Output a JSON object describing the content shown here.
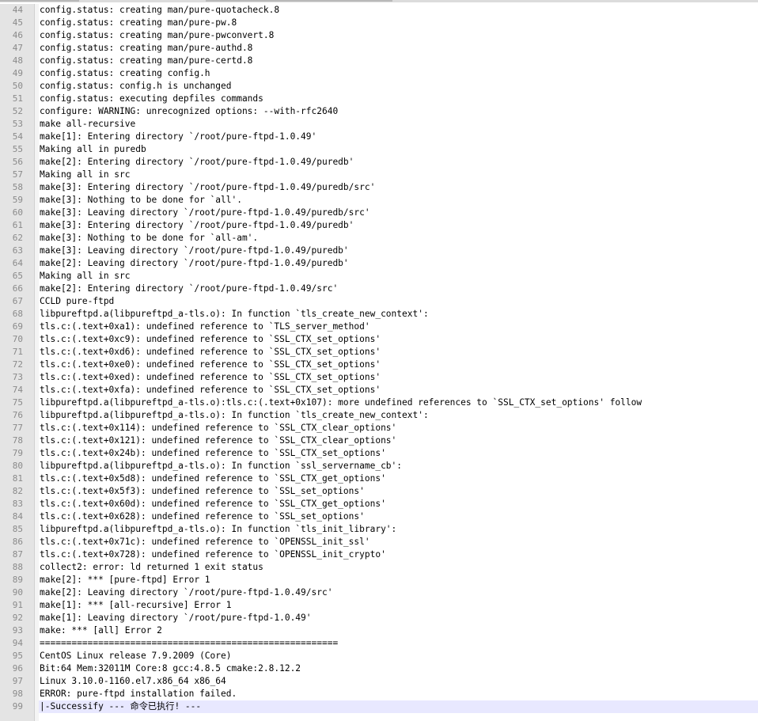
{
  "editor": {
    "current_line": 99,
    "lines": [
      {
        "n": 44,
        "text": "config.status: creating man/pure-quotacheck.8"
      },
      {
        "n": 45,
        "text": "config.status: creating man/pure-pw.8"
      },
      {
        "n": 46,
        "text": "config.status: creating man/pure-pwconvert.8"
      },
      {
        "n": 47,
        "text": "config.status: creating man/pure-authd.8"
      },
      {
        "n": 48,
        "text": "config.status: creating man/pure-certd.8"
      },
      {
        "n": 49,
        "text": "config.status: creating config.h"
      },
      {
        "n": 50,
        "text": "config.status: config.h is unchanged"
      },
      {
        "n": 51,
        "text": "config.status: executing depfiles commands"
      },
      {
        "n": 52,
        "text": "configure: WARNING: unrecognized options: --with-rfc2640"
      },
      {
        "n": 53,
        "text": "make all-recursive"
      },
      {
        "n": 54,
        "text": "make[1]: Entering directory `/root/pure-ftpd-1.0.49'"
      },
      {
        "n": 55,
        "text": "Making all in puredb"
      },
      {
        "n": 56,
        "text": "make[2]: Entering directory `/root/pure-ftpd-1.0.49/puredb'"
      },
      {
        "n": 57,
        "text": "Making all in src"
      },
      {
        "n": 58,
        "text": "make[3]: Entering directory `/root/pure-ftpd-1.0.49/puredb/src'"
      },
      {
        "n": 59,
        "text": "make[3]: Nothing to be done for `all'."
      },
      {
        "n": 60,
        "text": "make[3]: Leaving directory `/root/pure-ftpd-1.0.49/puredb/src'"
      },
      {
        "n": 61,
        "text": "make[3]: Entering directory `/root/pure-ftpd-1.0.49/puredb'"
      },
      {
        "n": 62,
        "text": "make[3]: Nothing to be done for `all-am'."
      },
      {
        "n": 63,
        "text": "make[3]: Leaving directory `/root/pure-ftpd-1.0.49/puredb'"
      },
      {
        "n": 64,
        "text": "make[2]: Leaving directory `/root/pure-ftpd-1.0.49/puredb'"
      },
      {
        "n": 65,
        "text": "Making all in src"
      },
      {
        "n": 66,
        "text": "make[2]: Entering directory `/root/pure-ftpd-1.0.49/src'"
      },
      {
        "n": 67,
        "text": "CCLD pure-ftpd"
      },
      {
        "n": 68,
        "text": "libpureftpd.a(libpureftpd_a-tls.o): In function `tls_create_new_context':"
      },
      {
        "n": 69,
        "text": "tls.c:(.text+0xa1): undefined reference to `TLS_server_method'"
      },
      {
        "n": 70,
        "text": "tls.c:(.text+0xc9): undefined reference to `SSL_CTX_set_options'"
      },
      {
        "n": 71,
        "text": "tls.c:(.text+0xd6): undefined reference to `SSL_CTX_set_options'"
      },
      {
        "n": 72,
        "text": "tls.c:(.text+0xe0): undefined reference to `SSL_CTX_set_options'"
      },
      {
        "n": 73,
        "text": "tls.c:(.text+0xed): undefined reference to `SSL_CTX_set_options'"
      },
      {
        "n": 74,
        "text": "tls.c:(.text+0xfa): undefined reference to `SSL_CTX_set_options'"
      },
      {
        "n": 75,
        "text": "libpureftpd.a(libpureftpd_a-tls.o):tls.c:(.text+0x107): more undefined references to `SSL_CTX_set_options' follow"
      },
      {
        "n": 76,
        "text": "libpureftpd.a(libpureftpd_a-tls.o): In function `tls_create_new_context':"
      },
      {
        "n": 77,
        "text": "tls.c:(.text+0x114): undefined reference to `SSL_CTX_clear_options'"
      },
      {
        "n": 78,
        "text": "tls.c:(.text+0x121): undefined reference to `SSL_CTX_clear_options'"
      },
      {
        "n": 79,
        "text": "tls.c:(.text+0x24b): undefined reference to `SSL_CTX_set_options'"
      },
      {
        "n": 80,
        "text": "libpureftpd.a(libpureftpd_a-tls.o): In function `ssl_servername_cb':"
      },
      {
        "n": 81,
        "text": "tls.c:(.text+0x5d8): undefined reference to `SSL_CTX_get_options'"
      },
      {
        "n": 82,
        "text": "tls.c:(.text+0x5f3): undefined reference to `SSL_set_options'"
      },
      {
        "n": 83,
        "text": "tls.c:(.text+0x60d): undefined reference to `SSL_CTX_get_options'"
      },
      {
        "n": 84,
        "text": "tls.c:(.text+0x628): undefined reference to `SSL_set_options'"
      },
      {
        "n": 85,
        "text": "libpureftpd.a(libpureftpd_a-tls.o): In function `tls_init_library':"
      },
      {
        "n": 86,
        "text": "tls.c:(.text+0x71c): undefined reference to `OPENSSL_init_ssl'"
      },
      {
        "n": 87,
        "text": "tls.c:(.text+0x728): undefined reference to `OPENSSL_init_crypto'"
      },
      {
        "n": 88,
        "text": "collect2: error: ld returned 1 exit status"
      },
      {
        "n": 89,
        "text": "make[2]: *** [pure-ftpd] Error 1"
      },
      {
        "n": 90,
        "text": "make[2]: Leaving directory `/root/pure-ftpd-1.0.49/src'"
      },
      {
        "n": 91,
        "text": "make[1]: *** [all-recursive] Error 1"
      },
      {
        "n": 92,
        "text": "make[1]: Leaving directory `/root/pure-ftpd-1.0.49'"
      },
      {
        "n": 93,
        "text": "make: *** [all] Error 2"
      },
      {
        "n": 94,
        "text": "========================================================"
      },
      {
        "n": 95,
        "text": "CentOS Linux release 7.9.2009 (Core)"
      },
      {
        "n": 96,
        "text": "Bit:64 Mem:32011M Core:8 gcc:4.8.5 cmake:2.8.12.2"
      },
      {
        "n": 97,
        "text": "Linux 3.10.0-1160.el7.x86_64 x86_64"
      },
      {
        "n": 98,
        "text": "ERROR: pure-ftpd installation failed."
      },
      {
        "n": 99,
        "text": "|-Successify --- 命令已执行! ---"
      }
    ]
  }
}
